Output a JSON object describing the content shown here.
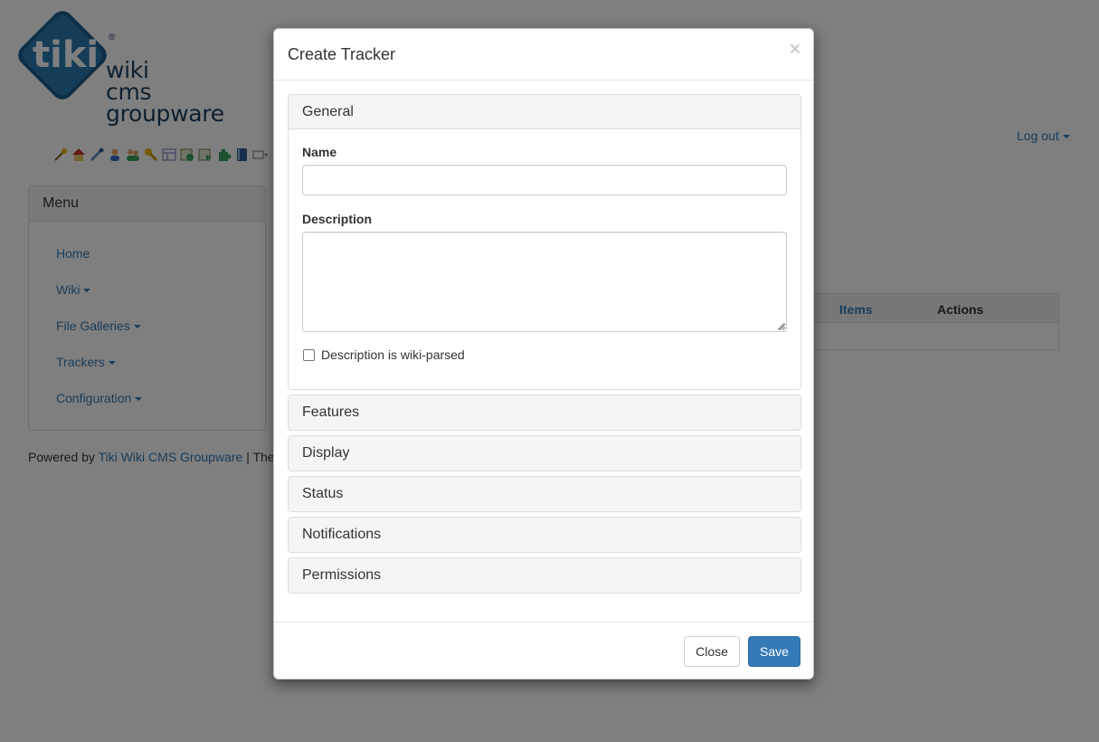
{
  "brand": {
    "logo_text": "tiki",
    "registered": "®",
    "words": [
      "wiki",
      "cms",
      "groupware"
    ]
  },
  "toolbar_icons": [
    "wizard-icon",
    "home-icon",
    "admin-tools-icon",
    "user-icon",
    "groups-icon",
    "permissions-icon",
    "modules-icon",
    "objects-icon",
    "import-export-icon",
    "plugins-icon",
    "book-icon",
    "dropdown-icon"
  ],
  "header": {
    "logout_label": "Log out"
  },
  "menu": {
    "title": "Menu",
    "items": [
      {
        "label": "Home",
        "has_caret": false
      },
      {
        "label": "Wiki",
        "has_caret": true
      },
      {
        "label": "File Galleries",
        "has_caret": true
      },
      {
        "label": "Trackers",
        "has_caret": true
      },
      {
        "label": "Configuration",
        "has_caret": true
      }
    ]
  },
  "footer": {
    "powered_prefix": "Powered by",
    "powered_link": "Tiki Wiki CMS Groupware",
    "powered_suffix": "| The"
  },
  "background_table": {
    "col_items": "Items",
    "col_actions": "Actions"
  },
  "modal": {
    "title": "Create Tracker",
    "close_symbol": "×",
    "sections": {
      "general": "General",
      "features": "Features",
      "display": "Display",
      "status": "Status",
      "notifications": "Notifications",
      "permissions": "Permissions"
    },
    "form": {
      "name_label": "Name",
      "name_value": "",
      "description_label": "Description",
      "description_value": "",
      "wiki_parsed_label": "Description is wiki-parsed",
      "wiki_parsed_checked": false
    },
    "buttons": {
      "close": "Close",
      "save": "Save"
    }
  },
  "colors": {
    "link": "#337ab7",
    "primary_button": "#337ab7",
    "logo_blue": "#1b5e8c",
    "backdrop": "rgba(0,0,0,0.5)"
  }
}
